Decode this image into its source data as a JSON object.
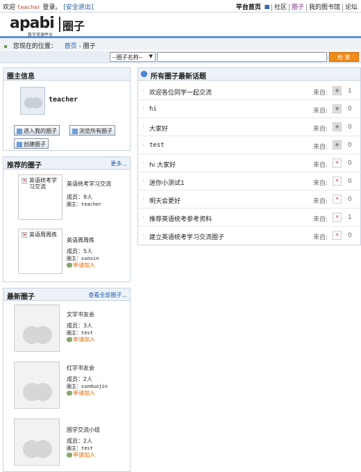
{
  "topbar": {
    "welcome": "欢迎",
    "username": "teacher",
    "login_text": "登录。",
    "logout": "[安全退出]",
    "nav": [
      "平台首页",
      "社区",
      "圈子",
      "我的图书馆",
      "论坛"
    ]
  },
  "header": {
    "logo_main": "apabi",
    "logo_sub": "数字资源平台",
    "section_title": "圈子"
  },
  "breadcrumb": {
    "prefix": "您现在的位置：",
    "home": "首页",
    "sep": "-",
    "current": "圈子"
  },
  "search": {
    "select_value": "--圈子名称--",
    "input_value": "",
    "button": "检 索"
  },
  "owner": {
    "title": "圈主信息",
    "name": "teacher",
    "btn_enter": "进入我的圈子",
    "btn_browse": "浏览所有圈子",
    "btn_create": "创建圈子"
  },
  "recommended": {
    "title": "推荐的圈子",
    "more": "更多...",
    "items": [
      {
        "thumb_text": "英语统考学习交流",
        "name": "英语统考学习交流",
        "members": "成员：9人",
        "owner": "圈主：teacher",
        "join": ""
      },
      {
        "thumb_text": "英语周周练",
        "name": "英语周周练",
        "members": "成员：5人",
        "owner": "圈主：sunxin",
        "join": "申请加入"
      }
    ]
  },
  "newest": {
    "title": "最新圈子",
    "more": "查看全部圈子...",
    "items": [
      {
        "name": "文学书友会",
        "members": "成员：3人",
        "owner": "圈主：test",
        "join": "申请加入"
      },
      {
        "name": "红学书友会",
        "members": "成员：2人",
        "owner": "圈主：sunduojin",
        "join": "申请加入"
      },
      {
        "name": "国学交流小组",
        "members": "成员：2人",
        "owner": "圈主：test",
        "join": "申请加入"
      }
    ]
  },
  "topics": {
    "title": "所有圈子最新话题",
    "from_label": "来自:",
    "rows": [
      {
        "title": "欢迎各位同学一起交流",
        "icon": "group-photo-icon",
        "count": "1"
      },
      {
        "title": "hi",
        "icon": "group-photo-icon",
        "count": "0"
      },
      {
        "title": "大家好",
        "icon": "group-photo-icon",
        "count": "0"
      },
      {
        "title": "test",
        "icon": "group-photo-icon",
        "count": "0"
      },
      {
        "title": "hi 大家好",
        "icon": "broken-image-icon",
        "count": "0"
      },
      {
        "title": "迷你小测试1",
        "icon": "broken-image-icon",
        "count": "0"
      },
      {
        "title": "明天会更好",
        "icon": "broken-image-icon",
        "count": "0"
      },
      {
        "title": "推荐英语统考参考资料",
        "icon": "broken-image-icon",
        "count": "1"
      },
      {
        "title": "建立英语统考学习交流圈子",
        "icon": "broken-image-icon",
        "count": "0"
      }
    ]
  }
}
